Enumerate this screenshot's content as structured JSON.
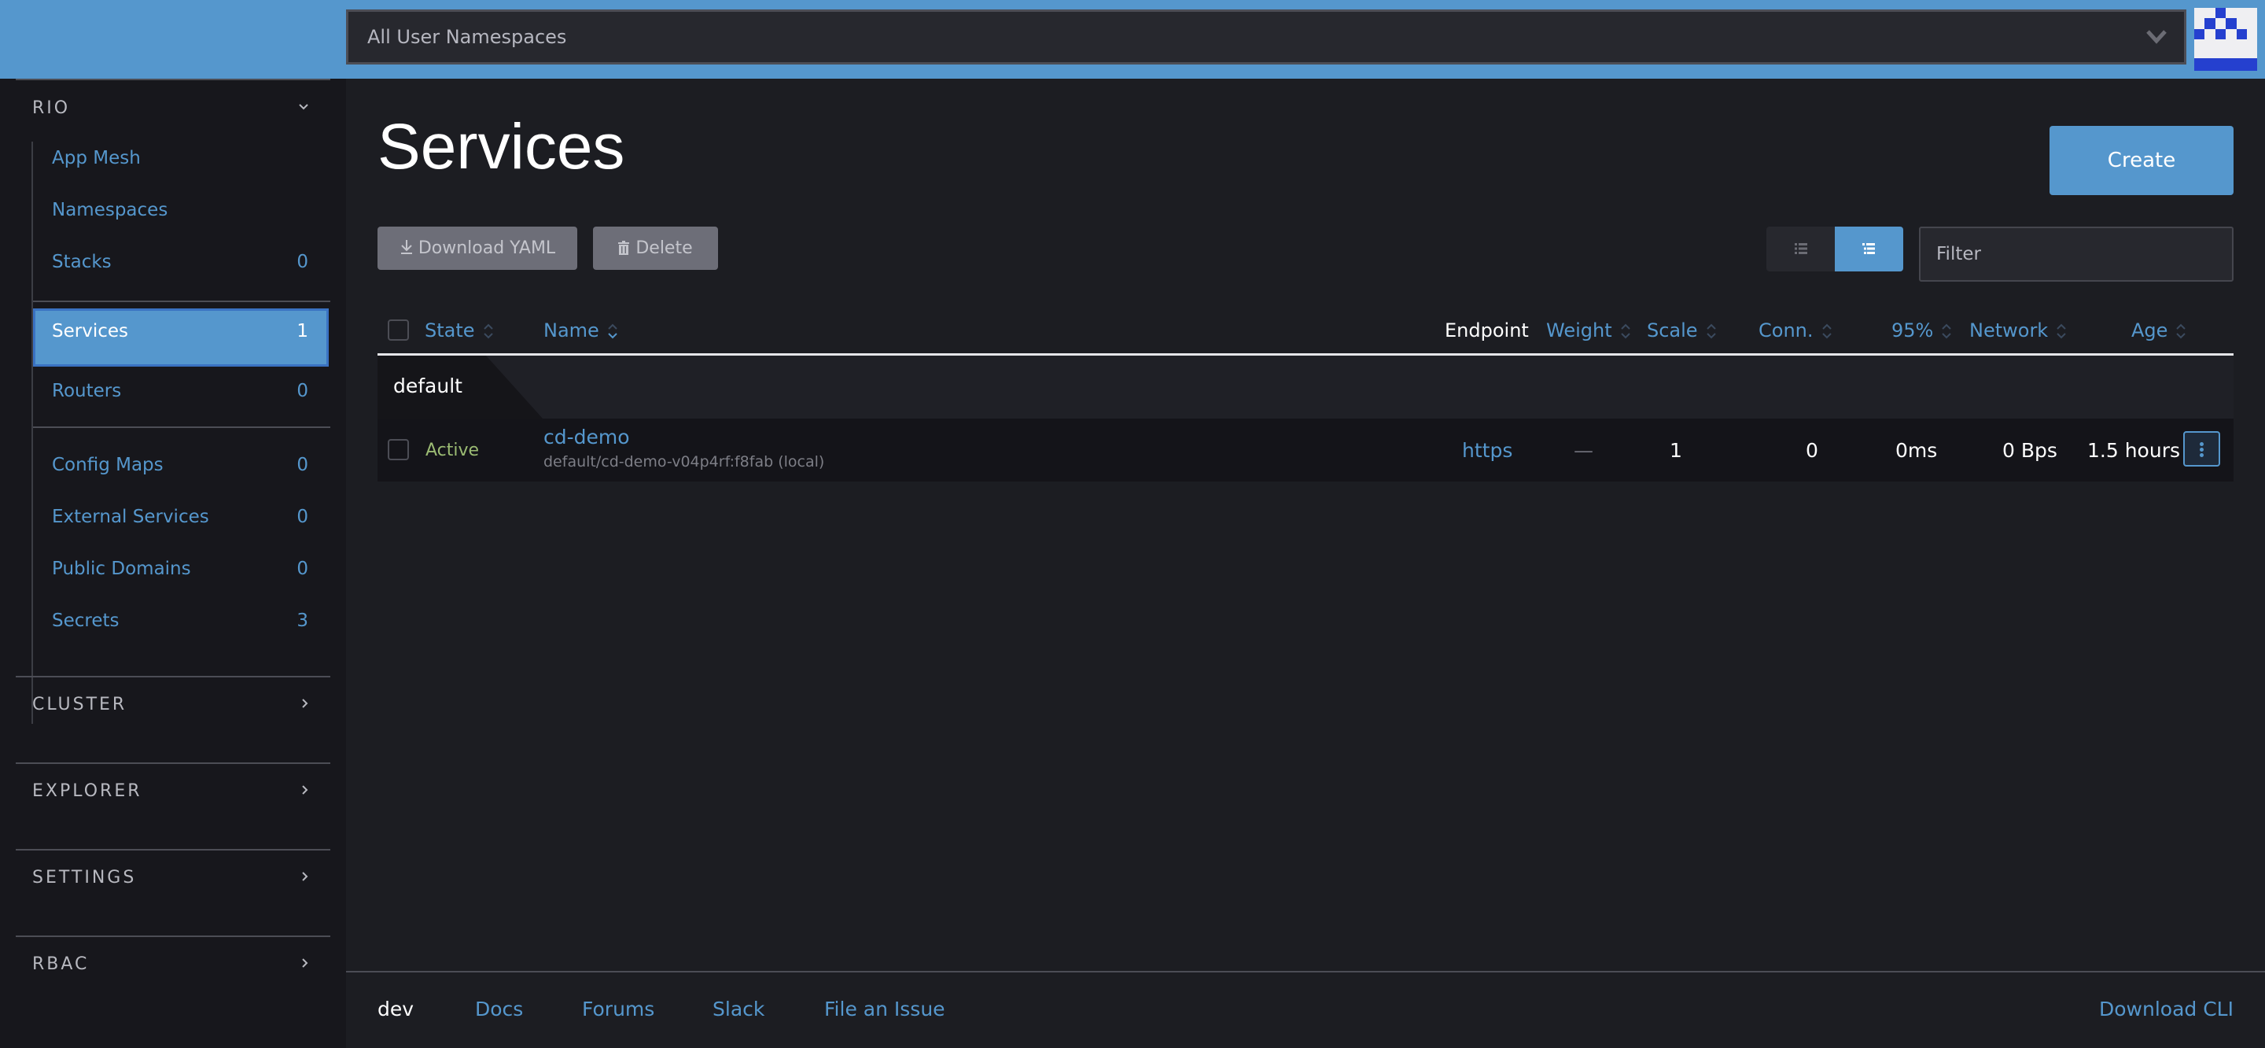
{
  "header": {
    "namespace_select": "All User Namespaces",
    "brand_color": "#5597cd"
  },
  "sidebar": {
    "groups": [
      {
        "label": "RIO",
        "expanded": true
      },
      {
        "label": "CLUSTER",
        "expanded": false
      },
      {
        "label": "EXPLORER",
        "expanded": false
      },
      {
        "label": "SETTINGS",
        "expanded": false
      },
      {
        "label": "RBAC",
        "expanded": false
      }
    ],
    "items": [
      {
        "label": "App Mesh",
        "count": ""
      },
      {
        "label": "Namespaces",
        "count": ""
      },
      {
        "label": "Stacks",
        "count": "0"
      },
      {
        "label": "Services",
        "count": "1",
        "active": true
      },
      {
        "label": "Routers",
        "count": "0"
      },
      {
        "label": "Config Maps",
        "count": "0"
      },
      {
        "label": "External Services",
        "count": "0"
      },
      {
        "label": "Public Domains",
        "count": "0"
      },
      {
        "label": "Secrets",
        "count": "3"
      }
    ]
  },
  "main": {
    "title": "Services",
    "create_label": "Create",
    "download_yaml_label": "Download YAML",
    "delete_label": "Delete",
    "filter_placeholder": "Filter",
    "view_toggle": {
      "options": [
        "flat-list",
        "grouped-list"
      ],
      "selected": "grouped-list"
    }
  },
  "table": {
    "columns": [
      "State",
      "Name",
      "Endpoint",
      "Weight",
      "Scale",
      "Conn.",
      "95%",
      "Network",
      "Age"
    ],
    "groups": [
      {
        "name": "default",
        "rows": [
          {
            "state": "Active",
            "name": "cd-demo",
            "subtitle": "default/cd-demo-v04p4rf:f8fab (local)",
            "endpoint": "https",
            "weight": "—",
            "scale": "1",
            "conn": "0",
            "p95": "0ms",
            "network": "0 Bps",
            "age": "1.5 hours"
          }
        ]
      }
    ]
  },
  "footer": {
    "version": "dev",
    "links": [
      "Docs",
      "Forums",
      "Slack",
      "File an Issue"
    ],
    "download_cli": "Download CLI"
  }
}
